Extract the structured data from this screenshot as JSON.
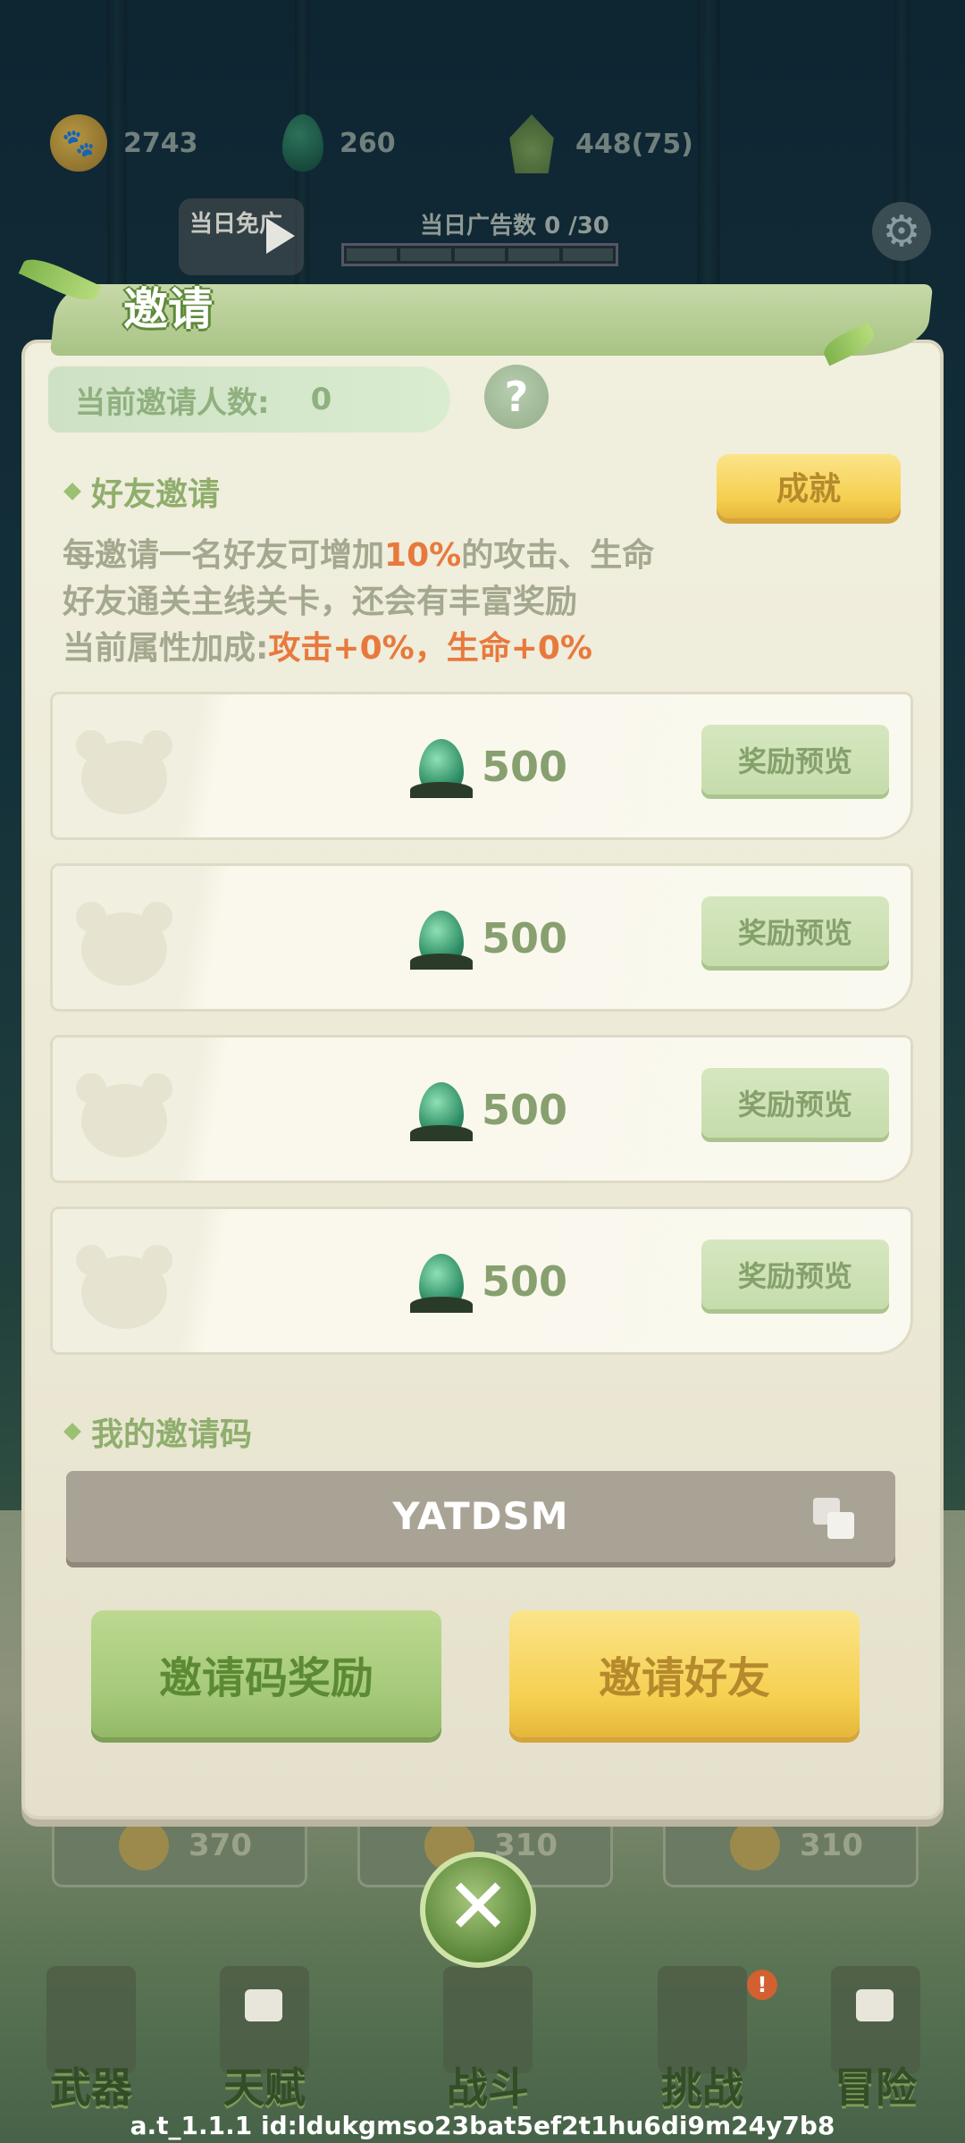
{
  "resources": {
    "coins": "2743",
    "gems": "260",
    "leaves": "448(75)"
  },
  "ad": {
    "free_label": "当日免广",
    "daily_label": "当日广告数",
    "daily_count": "0 /30"
  },
  "dialog": {
    "title": "邀请",
    "invite_count_label": "当前邀请人数:",
    "invite_count_value": "0",
    "help_icon_text": "?",
    "friend_section_title": "好友邀请",
    "achievement_label": "成就",
    "desc_line1_a": "每邀请一名好友可增加",
    "desc_line1_hl": "10%",
    "desc_line1_b": "的攻击、生命",
    "desc_line2": "好友通关主线关卡，还会有丰富奖励",
    "desc_line3_a": "当前属性加成:",
    "desc_line3_hl": "攻击+0%，生命+0%",
    "rewards": [
      {
        "amount": "500",
        "preview_label": "奖励预览"
      },
      {
        "amount": "500",
        "preview_label": "奖励预览"
      },
      {
        "amount": "500",
        "preview_label": "奖励预览"
      },
      {
        "amount": "500",
        "preview_label": "奖励预览"
      }
    ],
    "code_section_title": "我的邀请码",
    "invite_code": "YATDSM",
    "code_reward_label": "邀请码奖励",
    "invite_friends_label": "邀请好友"
  },
  "bottom": {
    "slots": [
      "370",
      "310",
      "310"
    ],
    "close_glyph": "✕",
    "nav": [
      {
        "label": "武器",
        "locked": false
      },
      {
        "label": "天赋",
        "locked": true
      },
      {
        "label": "战斗",
        "locked": false
      },
      {
        "label": "挑战",
        "locked": false
      },
      {
        "label": "冒险",
        "locked": true
      }
    ]
  },
  "version_text": "a.t_1.1.1 id:ldukgmso23bat5ef2t1hu6di9m24y7b8",
  "colors": {
    "accent_green": "#8fae6c",
    "highlight_orange": "#e8793d",
    "gold_button": "#f5cf4f"
  },
  "icons": [
    "paw-coin-icon",
    "gem-icon",
    "leaf-icon",
    "play-icon",
    "gear-icon",
    "help-icon",
    "bear-avatar-icon",
    "copy-icon",
    "close-icon",
    "lock-icon"
  ]
}
